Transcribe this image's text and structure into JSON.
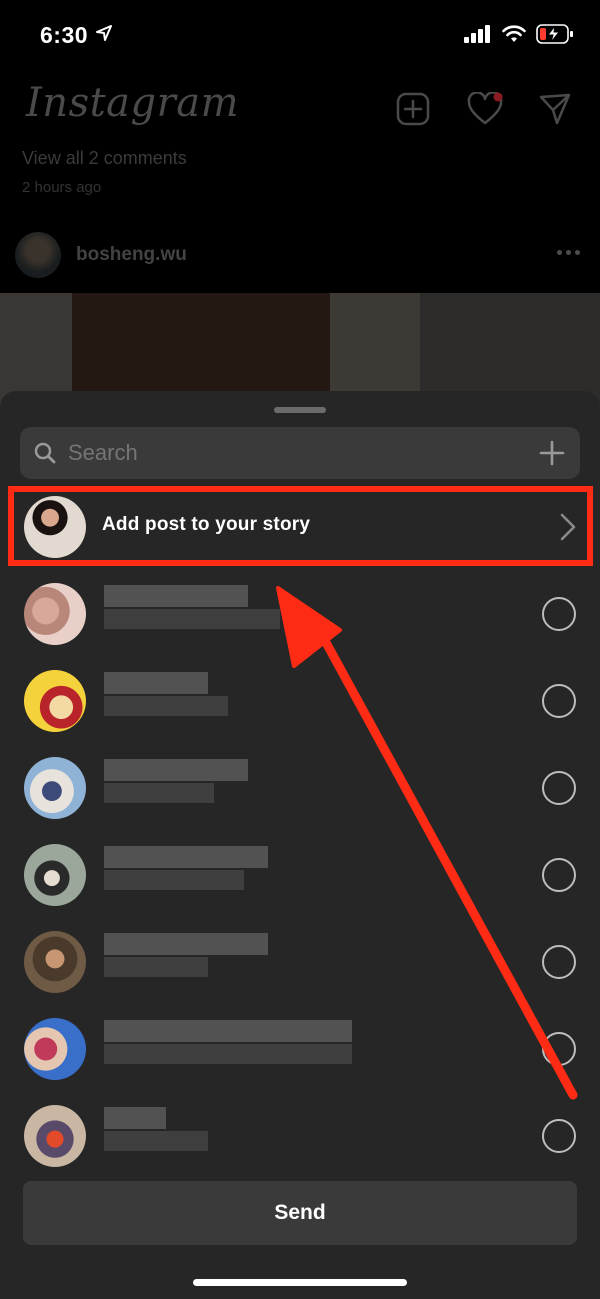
{
  "status_bar": {
    "time": "6:30"
  },
  "feed": {
    "logo_text": "Instagram",
    "comments_link": "View all 2 comments",
    "post_time": "2 hours ago",
    "post_username": "bosheng.wu"
  },
  "share_sheet": {
    "search_placeholder": "Search",
    "story_row_label": "Add post to your story",
    "send_label": "Send",
    "contacts_count_visible": 7
  },
  "colors": {
    "annotation": "#ff2b14",
    "sheet_bg": "#262626",
    "control_bg": "#3a3a3a"
  }
}
